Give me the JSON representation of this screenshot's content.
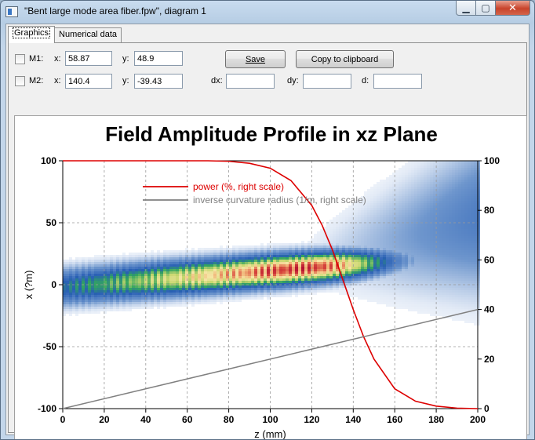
{
  "window": {
    "title": "\"Bent large mode area fiber.fpw\", diagram 1",
    "minimize_label": "▁",
    "maximize_label": "▢",
    "close_label": "✕"
  },
  "tabs": [
    {
      "label": "Graphics",
      "active": true
    },
    {
      "label": "Numerical data",
      "active": false
    }
  ],
  "markers": {
    "m1": {
      "label": "M1:",
      "x_label": "x:",
      "x_value": "58.87",
      "y_label": "y:",
      "y_value": "48.9"
    },
    "m2": {
      "label": "M2:",
      "x_label": "x:",
      "x_value": "140.4",
      "y_label": "y:",
      "y_value": "-39.43"
    }
  },
  "buttons": {
    "save_label": "Save",
    "copy_label": "Copy to clipboard"
  },
  "diffs": {
    "dx_label": "dx:",
    "dx_value": "",
    "dy_label": "dy:",
    "dy_value": "",
    "d_label": "d:",
    "d_value": ""
  },
  "chart_data": {
    "type": "heatmap",
    "title": "Field Amplitude Profile in xz Plane",
    "xlabel": "z (mm)",
    "ylabel": "x (?m)",
    "xlim": [
      0,
      200
    ],
    "ylim": [
      -100,
      100
    ],
    "right_ylim": [
      0,
      100
    ],
    "x_ticks": [
      0,
      20,
      40,
      60,
      80,
      100,
      120,
      140,
      160,
      180,
      200
    ],
    "y_ticks": [
      -100,
      -50,
      0,
      50,
      100
    ],
    "right_ticks": [
      0,
      20,
      40,
      60,
      80,
      100
    ],
    "grid": true,
    "legend_position": "top-center",
    "series": [
      {
        "name": "power (%, right scale)",
        "color": "#dd0000",
        "axis": "right",
        "x": [
          0,
          70,
          80,
          90,
          100,
          110,
          120,
          125,
          130,
          135,
          140,
          145,
          150,
          160,
          170,
          180,
          190,
          200
        ],
        "y": [
          100,
          100,
          99.8,
          99,
          97,
          92,
          82,
          74,
          64,
          52,
          40,
          29,
          20,
          8,
          3,
          1,
          0.2,
          0
        ]
      },
      {
        "name": "inverse curvature radius (1/m, right scale)",
        "color": "#808080",
        "axis": "right",
        "x": [
          0,
          200
        ],
        "y": [
          0,
          40
        ]
      }
    ],
    "field": {
      "center_start": -2,
      "center_end": 24,
      "width_start": 15,
      "width_end": 10,
      "peak_z": 105,
      "decay_z": 170,
      "radiation_spread": true
    }
  }
}
